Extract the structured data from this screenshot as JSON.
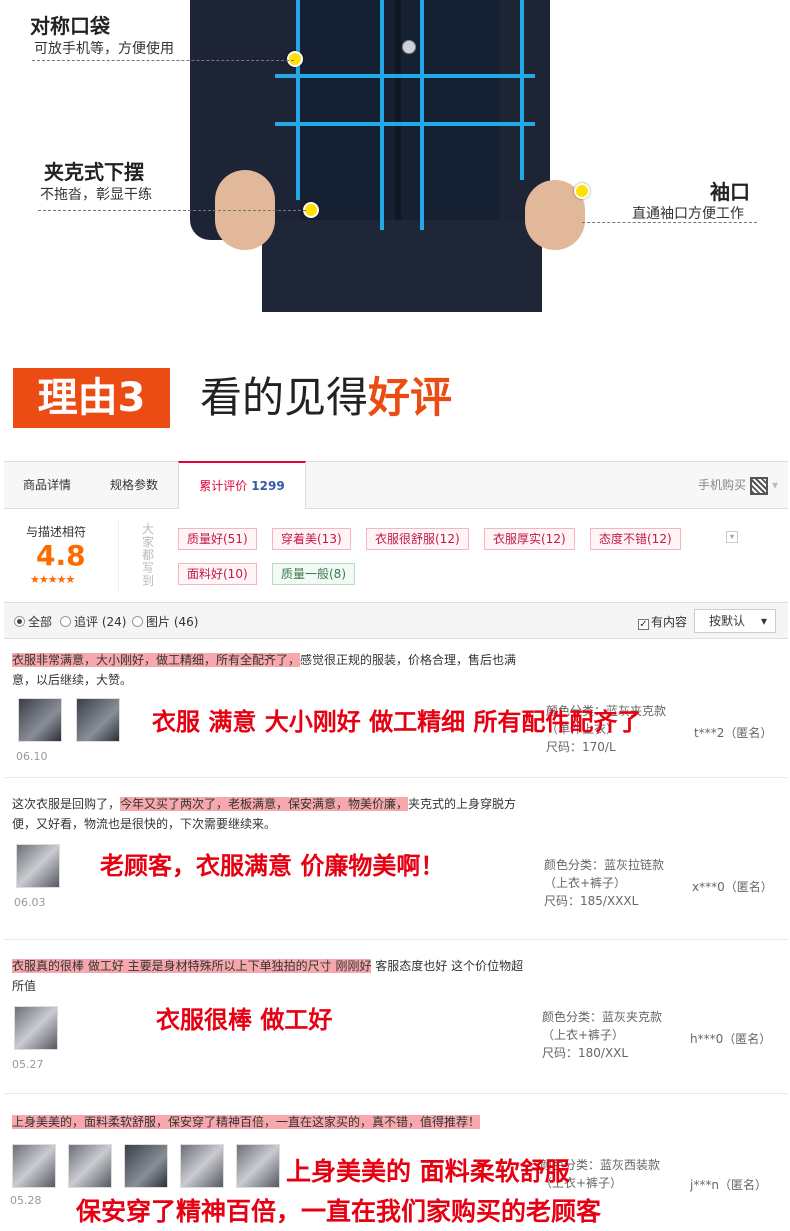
{
  "hero": {
    "pocket": {
      "title": "对称口袋",
      "sub": "可放手机等，方便使用"
    },
    "hem": {
      "title": "夹克式下摆",
      "sub": "不拖沓，彰显干练"
    },
    "cuff": {
      "title": "袖口",
      "sub": "直通袖口方便工作"
    }
  },
  "reason": {
    "badge": "理由3",
    "text_plain": "看的见得",
    "text_highlight": "好评"
  },
  "tabs": {
    "items": [
      "商品详情",
      "规格参数",
      "累计评价"
    ],
    "review_count": "1299",
    "mobile_buy": "手机购买"
  },
  "summary": {
    "score_label": "与描述相符",
    "score": "4.8",
    "stars": "★★★★★",
    "everyone_says": "大家都写到",
    "tags": [
      "质量好(51)",
      "穿着美(13)",
      "衣服很舒服(12)",
      "衣服厚实(12)",
      "态度不错(12)",
      "面料好(10)",
      "质量一般(8)"
    ],
    "expand_icon": "▾"
  },
  "filter": {
    "all": "全部",
    "followup": "追评 (24)",
    "pictures": "图片 (46)",
    "has_content": "有内容",
    "sort": "按默认",
    "sort_arrow": "▾"
  },
  "reviews": [
    {
      "highlight": "衣服非常满意，大小刚好，做工精细，所有全配齐了，",
      "rest": "感觉很正规的服装，价格合理，售后也满意，以后继续，大赞。",
      "date": "06.10",
      "sku_line1": "颜色分类：蓝灰夹克款",
      "sku_line2": "（单件上衣）",
      "sku_line3": "尺码：170/L",
      "user": "t***2（匿名）",
      "overlay": "衣服 满意 大小刚好 做工精细 所有配件配齐了"
    },
    {
      "lead": "这次衣服是回购了，",
      "highlight": "今年又买了两次了，老板满意，保安满意，物美价廉，",
      "rest": "夹克式的上身穿脱方便，又好看，物流也是很快的，下次需要继续来。",
      "date": "06.03",
      "sku_line1": "颜色分类：蓝灰拉链款",
      "sku_line2": "（上衣+裤子）",
      "sku_line3": "尺码：185/XXXL",
      "user": "x***0（匿名）",
      "overlay": "老顾客，衣服满意 价廉物美啊！"
    },
    {
      "highlight": "衣服真的很棒 做工好 主要是身材特殊所以上下单独拍的尺寸 刚刚好",
      "rest": " 客服态度也好 这个价位物超所值",
      "date": "05.27",
      "sku_line1": "颜色分类：蓝灰夹克款",
      "sku_line2": "（上衣+裤子）",
      "sku_line3": "尺码：180/XXL",
      "user": "h***0（匿名）",
      "overlay": "衣服很棒 做工好"
    },
    {
      "highlight": "上身美美的，面料柔软舒服，保安穿了精神百倍，一直在这家买的，真不错，值得推荐！",
      "date": "05.28",
      "sku_line1": "颜色分类：蓝灰西装款",
      "sku_line2": "（上衣+裤子）",
      "user": "j***n（匿名）",
      "overlay1": "上身美美的 面料柔软舒服",
      "overlay2": "保安穿了精神百倍，一直在我们家购买的老顾客"
    }
  ],
  "colors": {
    "accent": "#ea4c14",
    "tag_text": "#c2184b",
    "overlay_red": "#e60012",
    "measure_blue": "#22a9e6",
    "dot_yellow": "#ffe100"
  }
}
